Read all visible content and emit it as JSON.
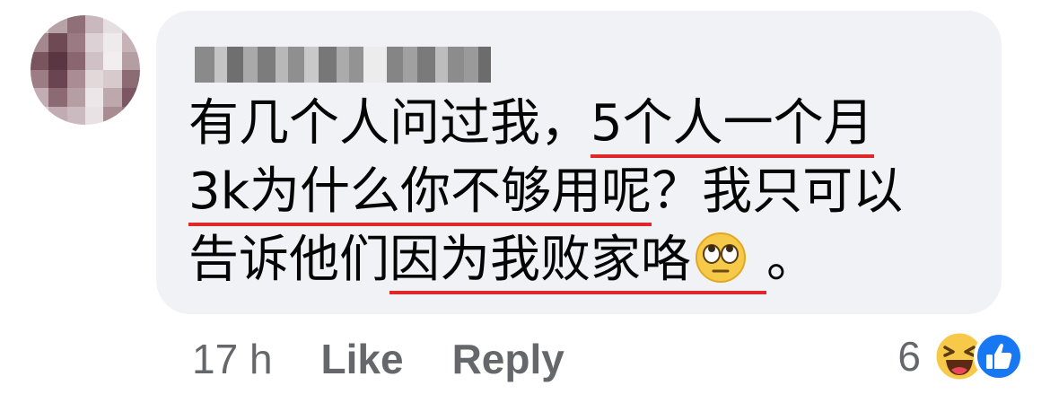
{
  "comment": {
    "author": "Meghley Pheng",
    "lines": [
      {
        "pre": "有几个人问过我，",
        "ul": "5个人一个月",
        "post": ""
      },
      {
        "pre": "",
        "ul": "3k为什么你不够用呢",
        "post": "？我只可以"
      },
      {
        "pre": "告诉他们",
        "ul": "因为我败家咯",
        "post": "。"
      }
    ]
  },
  "footer": {
    "time": "17 h",
    "like_label": "Like",
    "reply_label": "Reply"
  },
  "reactions": {
    "count": "6",
    "icons": [
      "laughing-reaction",
      "thumbs-up-reaction"
    ]
  },
  "colors": {
    "bubble": "#f0f2f5",
    "underline": "#e0262b",
    "like_blue": "#1877f2",
    "meta_grey": "#65676b"
  }
}
